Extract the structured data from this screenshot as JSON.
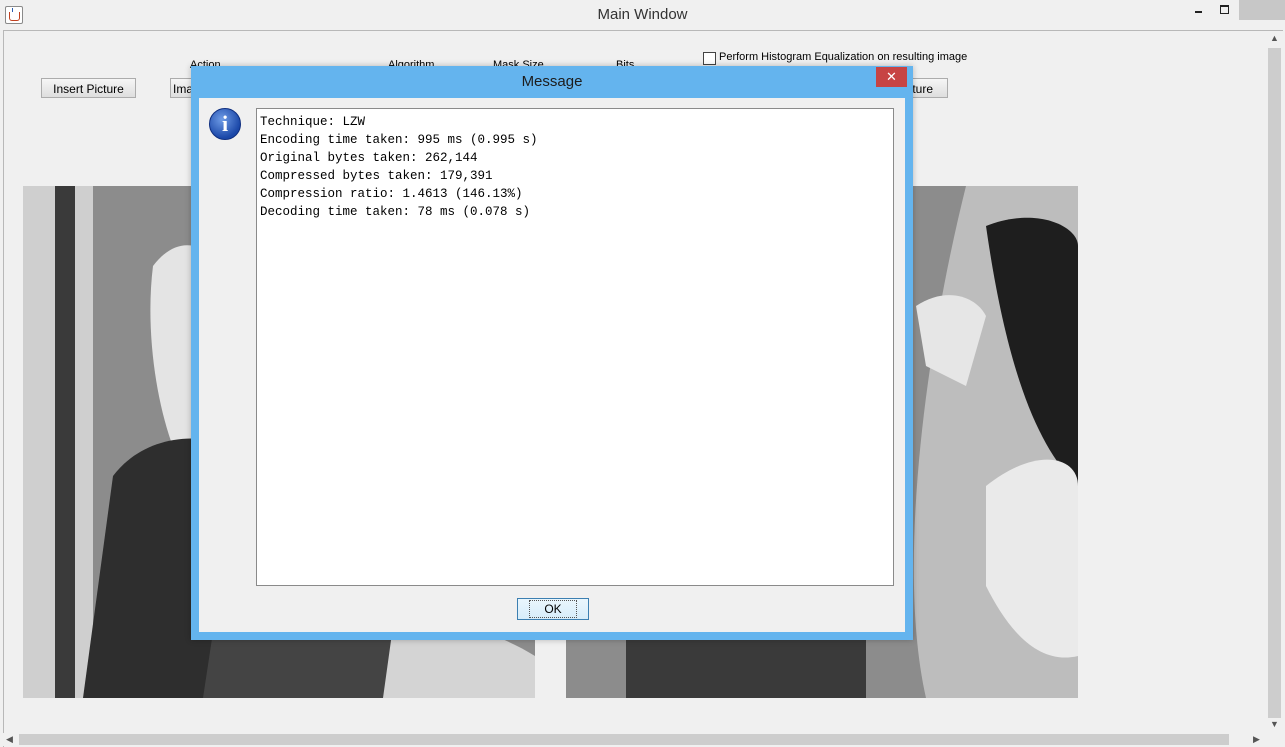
{
  "window": {
    "title": "Main Window",
    "minimize_glyph": "",
    "close_glyph": "",
    "histogram_checkbox_label": "Perform Histogram Equalization on resulting image",
    "histogram_checked": false
  },
  "toolbar": {
    "insert_picture": "Insert Picture",
    "image_button_partial": "Ima",
    "right_button_partial": "ture",
    "action_label": "Action",
    "algorithm_label": "Algorithm",
    "mask_size_label": "Mask Size",
    "bits_label": "Bits"
  },
  "dialog": {
    "title": "Message",
    "close_glyph": "✕",
    "icon": "information-icon",
    "icon_glyph": "i",
    "lines": [
      "Technique: LZW",
      "Encoding time taken: 995 ms (0.995 s)",
      "Original bytes taken: 262,144",
      "Compressed bytes taken: 179,391",
      "Compression ratio: 1.4613 (146.13%)",
      "",
      "Decoding time taken: 78 ms (0.078 s)"
    ],
    "ok_label": "OK"
  }
}
